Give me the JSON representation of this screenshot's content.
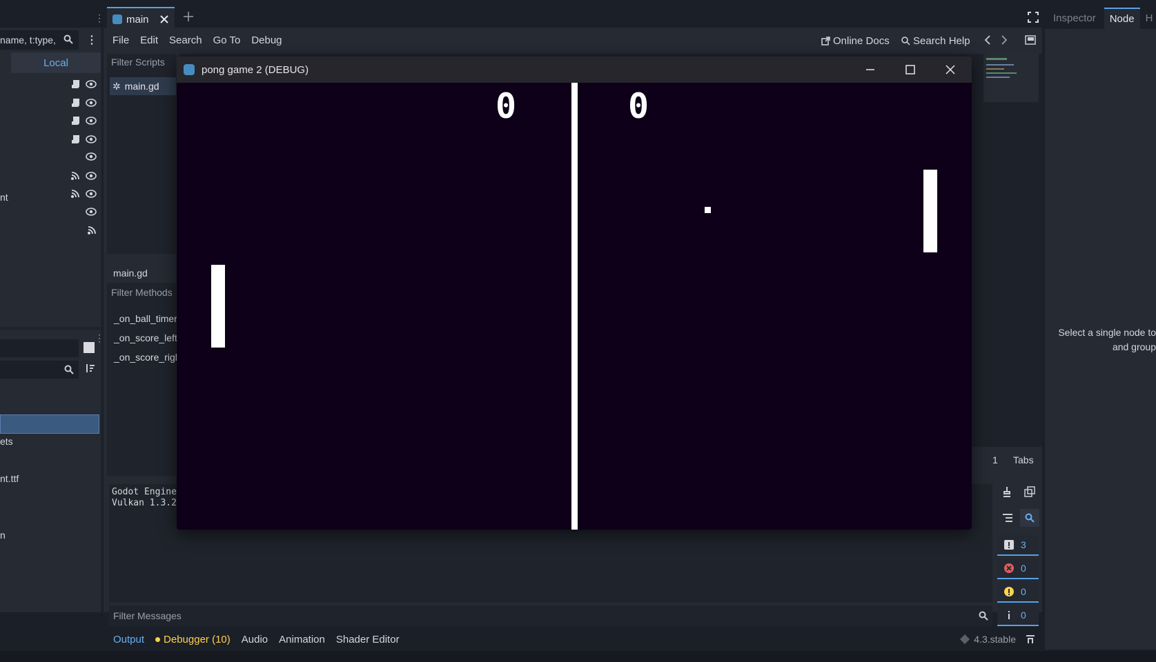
{
  "editor": {
    "top_tab": "main",
    "filter_placeholder": "name, t:type,",
    "local_label": "Local",
    "node_fragment": "nt",
    "fs_items": [
      "ets",
      "nt.ttf",
      "n"
    ],
    "menu": [
      "File",
      "Edit",
      "Search",
      "Go To",
      "Debug"
    ],
    "online_docs": "Online Docs",
    "search_help": "Search Help",
    "filter_scripts": "Filter Scripts",
    "script_item": "main.gd",
    "script_label": "main.gd",
    "filter_methods": "Filter Methods",
    "methods": [
      "_on_ball_timer",
      "_on_score_left",
      "_on_score_right"
    ],
    "output_lines": [
      "Godot Engine",
      "Vulkan 1.3.2"
    ],
    "line_col": ":",
    "line_num": "1",
    "tabs_label": "Tabs",
    "counts": [
      "3",
      "0",
      "0",
      "0"
    ],
    "filter_messages": "Filter Messages",
    "bottom_tabs": [
      "Output",
      "Debugger (10)",
      "Audio",
      "Animation",
      "Shader Editor"
    ],
    "version": "4.3.stable",
    "right_tabs": [
      "Inspector",
      "Node",
      "H"
    ],
    "node_message": [
      "Select a single node to",
      "and group"
    ],
    "colors": {
      "accent": "#5aa0e6",
      "warning": "#ffd24d",
      "error": "#e05d5d",
      "game_bg": "#0d0018"
    }
  },
  "game_window": {
    "title": "pong game 2 (DEBUG)",
    "score_left": "0",
    "score_right": "0"
  }
}
